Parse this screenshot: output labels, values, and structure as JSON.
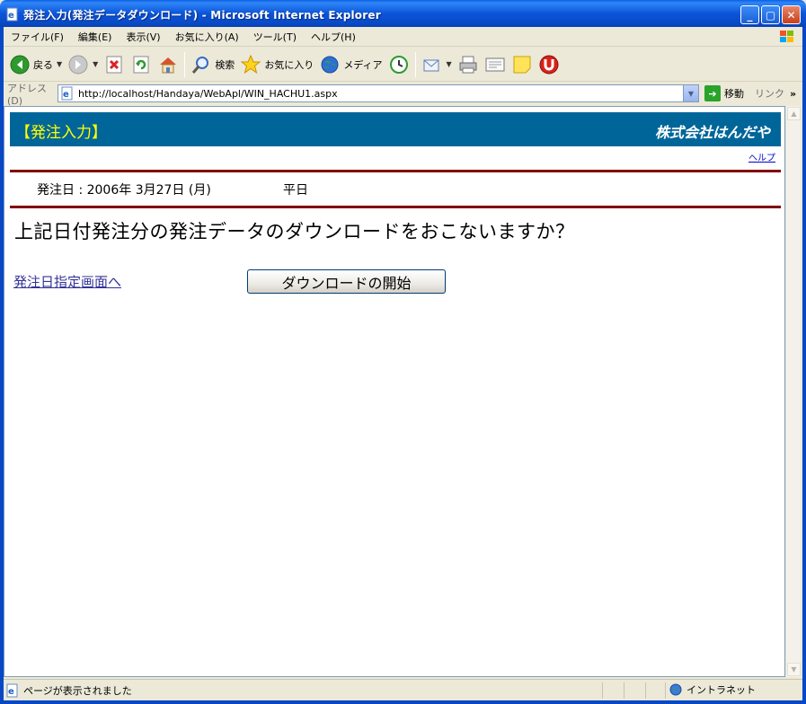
{
  "window": {
    "title": "発注入力(発注データダウンロード) - Microsoft Internet Explorer"
  },
  "menu": [
    "ファイル(F)",
    "編集(E)",
    "表示(V)",
    "お気に入り(A)",
    "ツール(T)",
    "ヘルプ(H)"
  ],
  "toolbar": {
    "back_label": "戻る",
    "search_label": "検索",
    "favorites_label": "お気に入り",
    "media_label": "メディア"
  },
  "address": {
    "label": "アドレス(D)",
    "url": "http://localhost/Handaya/WebApl/WIN_HACHU1.aspx",
    "go_label": "移動",
    "links_label": "リンク"
  },
  "page": {
    "title": "【発注入力】",
    "company": "株式会社はんだや",
    "help_link": "ヘルプ",
    "date_label": "発注日 : 2006年 3月27日 (月)",
    "day_type": "平日",
    "question": "上記日付発注分の発注データのダウンロードをおこないますか？",
    "back_link": "発注日指定画面へ",
    "download_button": "ダウンロードの開始"
  },
  "status": {
    "text": "ページが表示されました",
    "zone": "イントラネット"
  },
  "colors": {
    "header_bg": "#006699",
    "header_title": "#ffff00",
    "divider": "#800000",
    "link": "#333399"
  }
}
